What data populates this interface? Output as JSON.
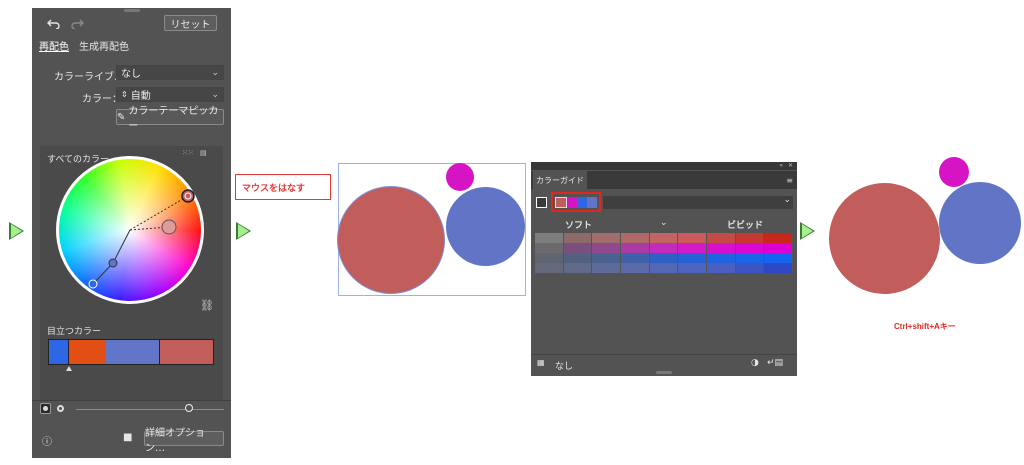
{
  "recolor": {
    "reset_label": "リセット",
    "tabs": [
      "再配色",
      "生成再配色"
    ],
    "library_label": "カラーライブ…",
    "library_value": "なし",
    "colors_label": "カラー：",
    "colors_value": "自動",
    "theme_picker_label": "カラーテーマピッカー",
    "all_colors_label": "すべてのカラー",
    "prominent_label": "目立つカラー",
    "prominent_colors": [
      "#2f66e6",
      "#e14f15",
      "#6176c9",
      "#c15e5c"
    ],
    "advanced_label": "詳細オプション…"
  },
  "annotation_release": "マウスをはなす",
  "circles": {
    "red": "#c15e5c",
    "blue": "#6174c6",
    "magenta": "#d714c4"
  },
  "guide": {
    "tab_label": "カラーガイド",
    "soft_label": "ソフト",
    "vivid_label": "ビビッド",
    "footer_none": "なし",
    "group_colors": [
      "#c15e5c",
      "#d714c4",
      "#2f66e6",
      "#6174c6"
    ],
    "rows": [
      [
        "#7d7d7d",
        "#8e6b6b",
        "#a16c6c",
        "#b16868",
        "#c26464",
        "#cd5a5a",
        "#c44a45",
        "#c73a34",
        "#c9261c"
      ],
      [
        "#6d6a6d",
        "#7a4f7d",
        "#8f4a8f",
        "#a93aa6",
        "#c12cba",
        "#d21cca",
        "#d70fcf",
        "#da08d2",
        "#dc00d4"
      ],
      [
        "#5f6570",
        "#52617f",
        "#4a628f",
        "#3f61a8",
        "#2f61c4",
        "#2661d6",
        "#1f64e0",
        "#1a66ea",
        "#1466f1"
      ],
      [
        "#65687a",
        "#626a8a",
        "#5e6a99",
        "#5b6aa8",
        "#5568b6",
        "#4f64bf",
        "#4b5fc2",
        "#3d55c3",
        "#2d48c4"
      ]
    ]
  },
  "shortcut_label": "Ctrl+shift+Aキー"
}
